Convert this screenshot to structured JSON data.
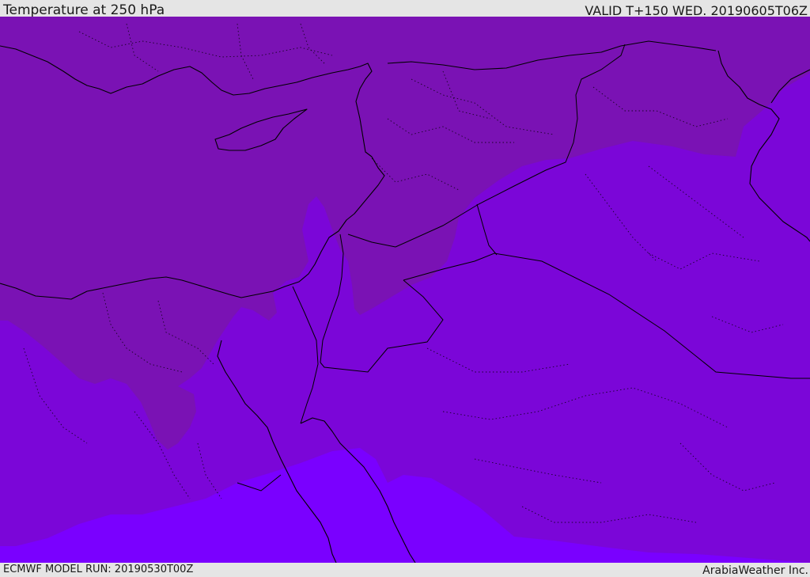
{
  "header": {
    "title": "Temperature at 250 hPa",
    "valid": "VALID T+150 WED. 20190605T06Z"
  },
  "footer": {
    "model_run": "ECMWF MODEL RUN: 20190530T00Z",
    "credit": "ArabiaWeather Inc."
  },
  "colors": {
    "band_warm": "#7a12b4",
    "band_mid": "#7b06d8",
    "band_cold": "#7a00ff",
    "frame": "#e5e5e5"
  }
}
